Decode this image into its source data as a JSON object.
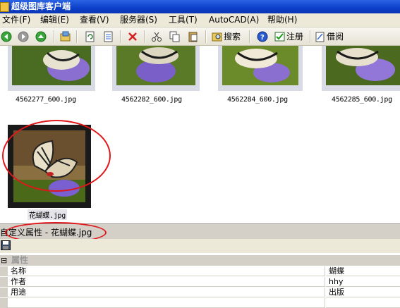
{
  "window": {
    "title": "超级图库客户端"
  },
  "menu": [
    {
      "label": "文件(F)"
    },
    {
      "label": "编辑(E)"
    },
    {
      "label": "查看(V)"
    },
    {
      "label": "服务器(S)"
    },
    {
      "label": "工具(T)"
    },
    {
      "label": "AutoCAD(A)"
    },
    {
      "label": "帮助(H)"
    }
  ],
  "toolbar": {
    "search_label": "搜索",
    "register_label": "注册",
    "borrow_label": "借阅"
  },
  "thumbnails": [
    {
      "caption": "4562277_600.jpg"
    },
    {
      "caption": "4562282_600.jpg"
    },
    {
      "caption": "4562284_600.jpg"
    },
    {
      "caption": "4562285_600.jpg"
    },
    {
      "caption": "花蝴蝶.jpg"
    }
  ],
  "properties_panel": {
    "header": "自定义属性 - 花蝴蝶.jpg",
    "category": "属性",
    "category_toggle": "⊟",
    "rows": [
      {
        "name": "名称",
        "value": "蝴蝶"
      },
      {
        "name": "作者",
        "value": "hhy"
      },
      {
        "name": "用途",
        "value": "出版"
      }
    ]
  },
  "colors": {
    "annotation_red": "#e0171a",
    "title_blue": "#0b3fc8"
  }
}
